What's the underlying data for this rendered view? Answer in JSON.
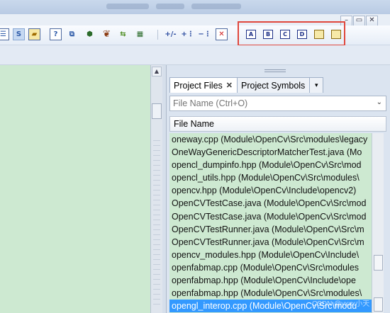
{
  "window_controls": {
    "minimize": "–",
    "restore": "▭",
    "close": "✕"
  },
  "toolbar": {
    "letter_buttons": [
      "A",
      "B",
      "C",
      "D",
      "",
      ""
    ]
  },
  "project_panel": {
    "tabs": [
      {
        "label": "Project Files",
        "close": "✕",
        "active": true
      },
      {
        "label": "Project Symbols",
        "active": false
      }
    ],
    "tab_menu": "▾",
    "filter": {
      "placeholder": "File Name (Ctrl+O)",
      "value": ""
    },
    "column_header": "File Name",
    "files": [
      "oneway.cpp (Module\\OpenCv\\Src\\modules\\legacy",
      "OneWayGenericDescriptorMatcherTest.java (Mo",
      "opencl_dumpinfo.hpp (Module\\OpenCv\\Src\\mod",
      "opencl_utils.hpp (Module\\OpenCv\\Src\\modules\\",
      "opencv.hpp (Module\\OpenCv\\Include\\opencv2)",
      "OpenCVTestCase.java (Module\\OpenCv\\Src\\mod",
      "OpenCVTestCase.java (Module\\OpenCv\\Src\\mod",
      "OpenCVTestRunner.java (Module\\OpenCv\\Src\\m",
      "OpenCVTestRunner.java (Module\\OpenCv\\Src\\m",
      "opencv_modules.hpp (Module\\OpenCv\\Include\\",
      "openfabmap.cpp (Module\\OpenCv\\Src\\modules",
      "openfabmap.hpp (Module\\OpenCv\\Include\\ope",
      "openfabmap.hpp (Module\\OpenCv\\Src\\modules\\",
      "opengl_interop.cpp (Module\\OpenCv\\Src\\modu"
    ],
    "selected_index": 13
  },
  "watermark": "CSDN @yxxx小天"
}
